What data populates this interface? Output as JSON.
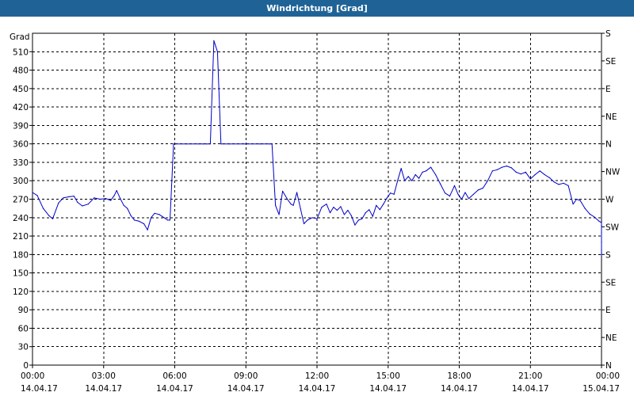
{
  "window": {
    "title": "Windrichtung [Grad]"
  },
  "colors": {
    "title_bar": "#1f6396",
    "title_text": "#ffffff",
    "series": "#0000c8",
    "grid": "#000000"
  },
  "chart_data": {
    "type": "line",
    "title": "Windrichtung [Grad]",
    "ylabel": "Grad",
    "xlabel": "",
    "ylim": [
      0,
      540
    ],
    "xlim": [
      0,
      24
    ],
    "grid": true,
    "y_ticks": [
      0,
      30,
      60,
      90,
      120,
      150,
      180,
      210,
      240,
      270,
      300,
      330,
      360,
      390,
      420,
      450,
      480,
      510
    ],
    "right_axis_ticks": [
      {
        "value": 0,
        "label": "N"
      },
      {
        "value": 45,
        "label": "NE"
      },
      {
        "value": 90,
        "label": "E"
      },
      {
        "value": 135,
        "label": "SE"
      },
      {
        "value": 180,
        "label": "S"
      },
      {
        "value": 225,
        "label": "SW"
      },
      {
        "value": 270,
        "label": "W"
      },
      {
        "value": 315,
        "label": "NW"
      },
      {
        "value": 360,
        "label": "N"
      },
      {
        "value": 405,
        "label": "NE"
      },
      {
        "value": 450,
        "label": "E"
      },
      {
        "value": 495,
        "label": "SE"
      },
      {
        "value": 540,
        "label": "S"
      }
    ],
    "x_ticks": [
      {
        "value": 0,
        "time": "00:00",
        "date": "14.04.17"
      },
      {
        "value": 3,
        "time": "03:00",
        "date": "14.04.17"
      },
      {
        "value": 6,
        "time": "06:00",
        "date": "14.04.17"
      },
      {
        "value": 9,
        "time": "09:00",
        "date": "14.04.17"
      },
      {
        "value": 12,
        "time": "12:00",
        "date": "14.04.17"
      },
      {
        "value": 15,
        "time": "15:00",
        "date": "14.04.17"
      },
      {
        "value": 18,
        "time": "18:00",
        "date": "14.04.17"
      },
      {
        "value": 21,
        "time": "21:00",
        "date": "14.04.17"
      },
      {
        "value": 24,
        "time": "00:00",
        "date": "15.04.17"
      }
    ],
    "series": [
      {
        "values": [
          [
            0.0,
            281
          ],
          [
            0.2,
            276
          ],
          [
            0.45,
            255
          ],
          [
            0.7,
            243
          ],
          [
            0.85,
            238
          ],
          [
            1.1,
            264
          ],
          [
            1.3,
            272
          ],
          [
            1.55,
            274
          ],
          [
            1.75,
            275
          ],
          [
            1.9,
            265
          ],
          [
            2.1,
            259
          ],
          [
            2.35,
            262
          ],
          [
            2.6,
            272
          ],
          [
            2.85,
            270
          ],
          [
            3.1,
            271
          ],
          [
            3.3,
            268
          ],
          [
            3.45,
            276
          ],
          [
            3.55,
            284
          ],
          [
            3.7,
            271
          ],
          [
            3.85,
            260
          ],
          [
            4.0,
            255
          ],
          [
            4.15,
            243
          ],
          [
            4.3,
            236
          ],
          [
            4.5,
            234
          ],
          [
            4.7,
            230
          ],
          [
            4.85,
            220
          ],
          [
            5.0,
            240
          ],
          [
            5.15,
            247
          ],
          [
            5.35,
            245
          ],
          [
            5.55,
            240
          ],
          [
            5.7,
            236
          ],
          [
            5.8,
            236
          ],
          [
            5.95,
            360
          ],
          [
            6.5,
            360
          ],
          [
            7.0,
            360
          ],
          [
            7.2,
            360
          ],
          [
            7.35,
            360
          ],
          [
            7.5,
            360
          ],
          [
            7.65,
            528
          ],
          [
            7.8,
            510
          ],
          [
            7.95,
            360
          ],
          [
            8.3,
            360
          ],
          [
            9.0,
            360
          ],
          [
            9.6,
            360
          ],
          [
            10.0,
            360
          ],
          [
            10.1,
            360
          ],
          [
            10.25,
            260
          ],
          [
            10.4,
            245
          ],
          [
            10.55,
            283
          ],
          [
            10.75,
            270
          ],
          [
            10.9,
            262
          ],
          [
            11.0,
            260
          ],
          [
            11.15,
            281
          ],
          [
            11.3,
            255
          ],
          [
            11.45,
            230
          ],
          [
            11.6,
            236
          ],
          [
            11.8,
            240
          ],
          [
            12.0,
            238
          ],
          [
            12.2,
            257
          ],
          [
            12.4,
            262
          ],
          [
            12.55,
            248
          ],
          [
            12.7,
            257
          ],
          [
            12.85,
            252
          ],
          [
            13.0,
            258
          ],
          [
            13.15,
            245
          ],
          [
            13.3,
            252
          ],
          [
            13.45,
            243
          ],
          [
            13.6,
            228
          ],
          [
            13.75,
            236
          ],
          [
            13.9,
            238
          ],
          [
            14.05,
            248
          ],
          [
            14.2,
            253
          ],
          [
            14.35,
            242
          ],
          [
            14.5,
            260
          ],
          [
            14.65,
            253
          ],
          [
            14.8,
            262
          ],
          [
            14.95,
            272
          ],
          [
            15.1,
            280
          ],
          [
            15.25,
            278
          ],
          [
            15.4,
            300
          ],
          [
            15.55,
            320
          ],
          [
            15.7,
            300
          ],
          [
            15.85,
            307
          ],
          [
            16.0,
            300
          ],
          [
            16.15,
            310
          ],
          [
            16.3,
            304
          ],
          [
            16.45,
            314
          ],
          [
            16.6,
            316
          ],
          [
            16.8,
            322
          ],
          [
            17.0,
            310
          ],
          [
            17.2,
            295
          ],
          [
            17.4,
            280
          ],
          [
            17.6,
            275
          ],
          [
            17.8,
            292
          ],
          [
            17.95,
            278
          ],
          [
            18.1,
            270
          ],
          [
            18.25,
            281
          ],
          [
            18.4,
            271
          ],
          [
            18.6,
            278
          ],
          [
            18.8,
            285
          ],
          [
            19.0,
            288
          ],
          [
            19.2,
            300
          ],
          [
            19.4,
            316
          ],
          [
            19.6,
            318
          ],
          [
            19.8,
            322
          ],
          [
            20.0,
            324
          ],
          [
            20.2,
            321
          ],
          [
            20.4,
            314
          ],
          [
            20.6,
            311
          ],
          [
            20.8,
            314
          ],
          [
            21.0,
            303
          ],
          [
            21.2,
            310
          ],
          [
            21.4,
            316
          ],
          [
            21.6,
            310
          ],
          [
            21.8,
            305
          ],
          [
            22.0,
            298
          ],
          [
            22.2,
            294
          ],
          [
            22.4,
            296
          ],
          [
            22.6,
            292
          ],
          [
            22.8,
            262
          ],
          [
            22.95,
            270
          ],
          [
            23.1,
            268
          ],
          [
            23.3,
            255
          ],
          [
            23.5,
            246
          ],
          [
            23.7,
            241
          ],
          [
            23.9,
            234
          ],
          [
            24.1,
            232
          ],
          [
            24.3,
            228
          ],
          [
            24.5,
            226
          ],
          [
            24.7,
            216
          ],
          [
            24.85,
            200
          ],
          [
            25.0,
            188
          ],
          [
            25.15,
            180
          ],
          [
            25.3,
            182
          ],
          [
            25.45,
            177
          ]
        ]
      }
    ]
  }
}
